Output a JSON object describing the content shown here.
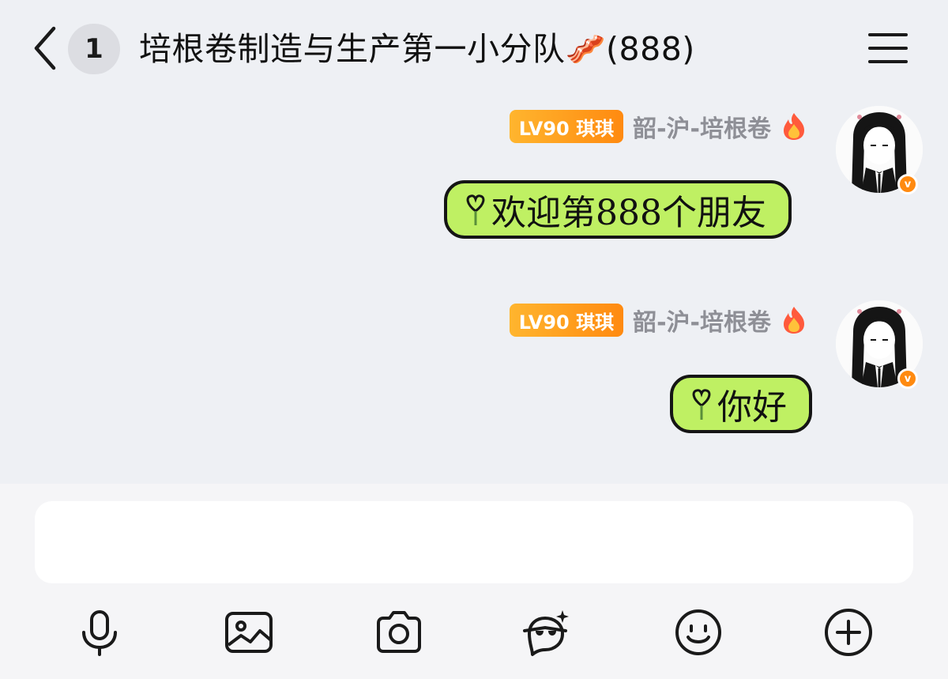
{
  "header": {
    "unread_count": "1",
    "title": "培根卷制造与生产第一小分队🥓(888)",
    "icons": {
      "back": "chevron-left-icon",
      "menu": "hamburger-menu-icon"
    }
  },
  "messages": [
    {
      "level_badge": "LV90 琪琪",
      "sender": "韶-沪-培根卷",
      "text": "欢迎第888个朋友"
    },
    {
      "level_badge": "LV90 琪琪",
      "sender": "韶-沪-培根卷",
      "text": "你好"
    }
  ],
  "input": {
    "placeholder": "",
    "value": ""
  },
  "toolbar": [
    {
      "name": "voice",
      "icon": "microphone-icon"
    },
    {
      "name": "image",
      "icon": "image-icon"
    },
    {
      "name": "camera",
      "icon": "camera-icon"
    },
    {
      "name": "sticker",
      "icon": "mask-sparkle-icon"
    },
    {
      "name": "emoji",
      "icon": "smiley-icon"
    },
    {
      "name": "more",
      "icon": "plus-circle-icon"
    }
  ],
  "colors": {
    "bubble": "#bff063",
    "bubble_border": "#151515",
    "level_badge": "#ff9a1f",
    "background": "#eef0f4",
    "bottom_bar": "#f5f5f7"
  }
}
